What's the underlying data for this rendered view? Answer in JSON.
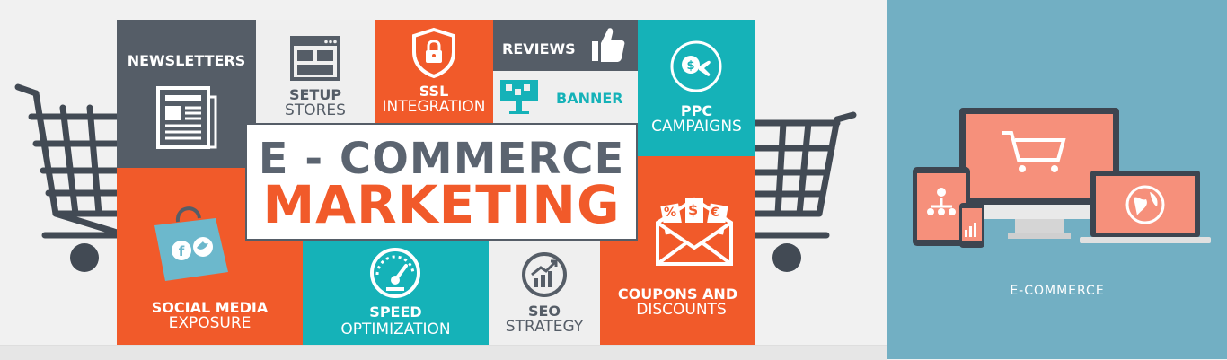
{
  "hero": {
    "title_line1": "E - COMMERCE",
    "title_line2": "MARKETING"
  },
  "tiles": {
    "newsletters": "NEWSLETTERS",
    "setup_bold": "SETUP",
    "setup_rest": "STORES",
    "ssl_bold": "SSL",
    "ssl_rest": "INTEGRATION",
    "reviews": "REVIEWS",
    "banner": "BANNER",
    "ppc_bold": "PPC",
    "ppc_rest": "CAMPAIGNS",
    "social_bold": "SOCIAL MEDIA",
    "social_rest": "EXPOSURE",
    "speed_bold": "SPEED",
    "speed_rest": "OPTIMIZATION",
    "seo_bold": "SEO",
    "seo_rest": "STRATEGY",
    "coupons_bold": "COUPONS AND",
    "coupons_rest": "DISCOUNTS"
  },
  "coupon_symbols": [
    "%",
    "$",
    "€"
  ],
  "right_panel": {
    "label": "E-COMMERCE"
  },
  "colors": {
    "slate": "#555d67",
    "orange": "#f15a2a",
    "teal": "#15b2b8",
    "light": "#efefef",
    "panel_blue": "#72afc3",
    "salmon": "#f6907b"
  },
  "icons": [
    "shopping-cart-icon",
    "newspaper-icon",
    "browser-window-icon",
    "lock-shield-icon",
    "thumbs-up-icon",
    "billboard-icon",
    "coin-hand-icon",
    "shopping-bag-icon",
    "speedometer-icon",
    "growth-chart-icon",
    "envelope-coupons-icon",
    "monitor-icon",
    "tablet-icon",
    "phone-icon",
    "laptop-icon"
  ]
}
